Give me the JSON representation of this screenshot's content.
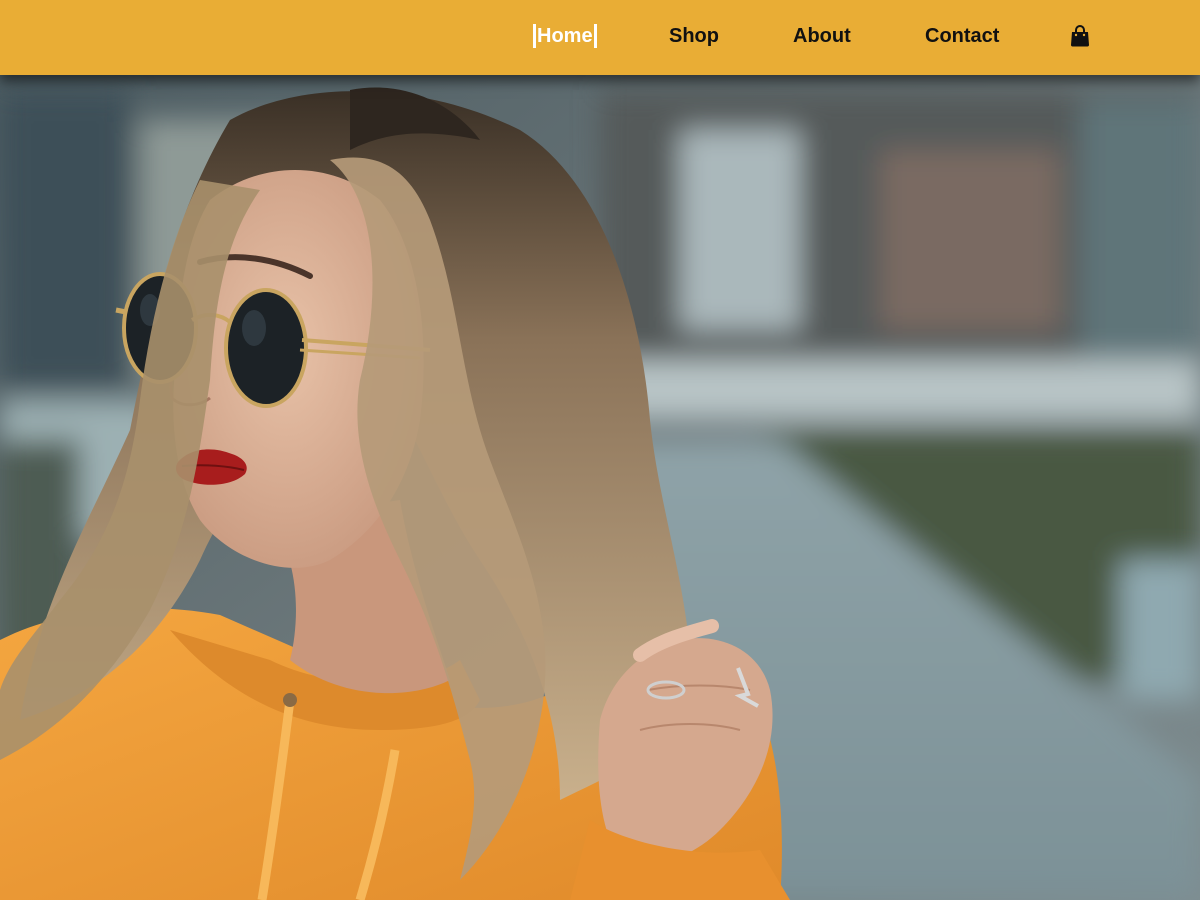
{
  "nav": {
    "items": [
      {
        "label": "Home",
        "active": true
      },
      {
        "label": "Shop",
        "active": false
      },
      {
        "label": "About",
        "active": false
      },
      {
        "label": "Contact",
        "active": false
      }
    ],
    "cart_icon": "shopping-bag-icon"
  },
  "colors": {
    "navbar_bg": "#e9ad35",
    "nav_text": "#111111",
    "nav_active_text": "#ffffff",
    "hoodie": "#ef9a35",
    "lips": "#a81d1d"
  }
}
